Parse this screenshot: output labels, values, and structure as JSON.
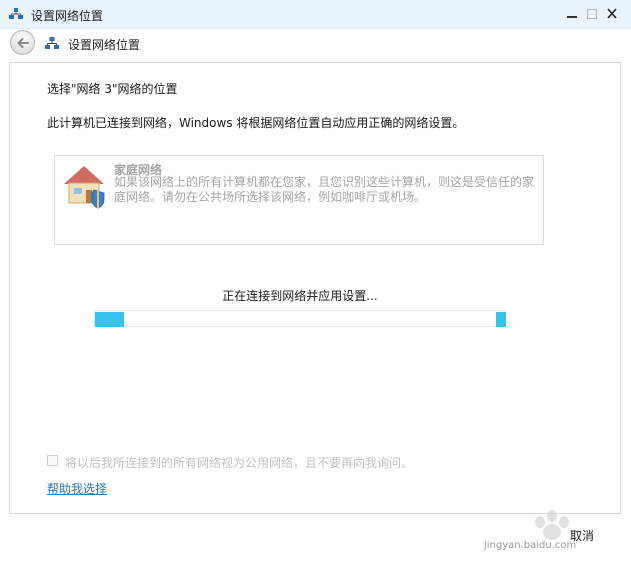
{
  "window": {
    "title": "设置网络位置",
    "icon": "network-icon"
  },
  "nav": {
    "title": "设置网络位置",
    "back_icon": "back-arrow-icon"
  },
  "main": {
    "heading": "选择\"网络 3\"网络的位置",
    "description": "此计算机已连接到网络，Windows 将根据网络位置自动应用正确的网络设置。",
    "option": {
      "title": "家庭网络",
      "description": "如果该网络上的所有计算机都在您家，且您识别这些计算机，则这是受信任的家庭网络。请勿在公共场所选择该网络，例如咖啡厅或机场。",
      "icon": "home-network-icon"
    },
    "status": "正在连接到网络并应用设置...",
    "progress": {
      "state": "indeterminate",
      "accent": "#35c2ec"
    },
    "checkbox_label": "将以后我所连接到的所有网络视为公用网络，且不要再向我询问。",
    "help_link": "帮助我选择"
  },
  "footer": {
    "cancel_label": "取消"
  },
  "watermark": {
    "text": "jingyan.baidu.com",
    "icon": "baidu-paw-icon"
  }
}
